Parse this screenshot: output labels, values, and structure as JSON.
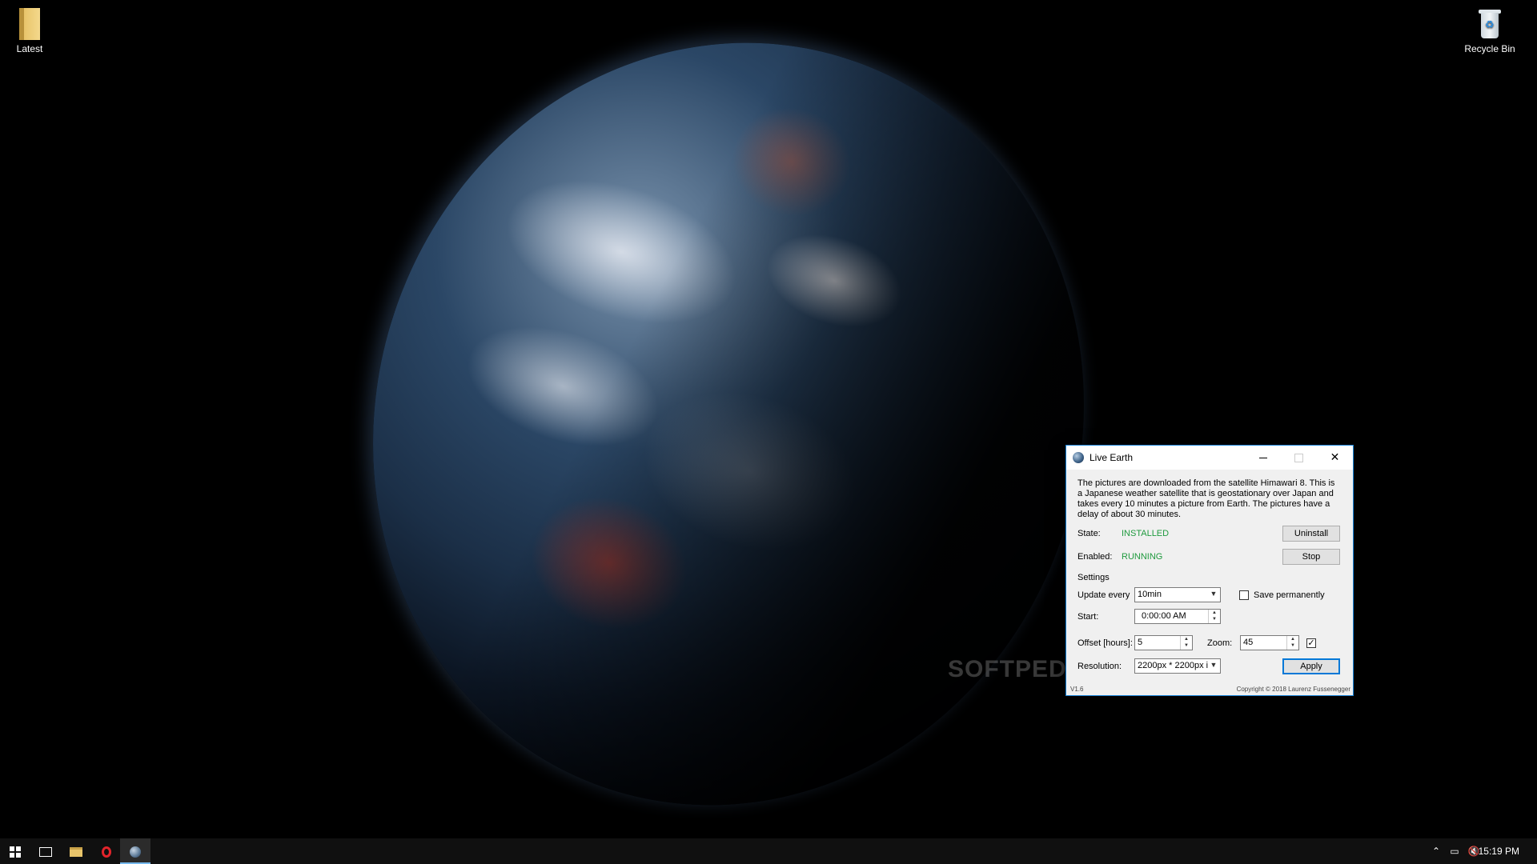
{
  "desktop": {
    "icons": [
      {
        "label": "Latest",
        "icon": "folder-icon"
      },
      {
        "label": "Recycle Bin",
        "icon": "recycle-bin-icon"
      }
    ],
    "watermark": "SOFTPEDIA"
  },
  "window": {
    "title": "Live Earth",
    "description": "The pictures are downloaded from the satellite Himawari 8. This is a Japanese weather satellite that is geostationary over Japan and takes every 10 minutes a picture from Earth. The pictures have a delay of about 30 minutes.",
    "state_label": "State:",
    "state_value": "INSTALLED",
    "enabled_label": "Enabled:",
    "enabled_value": "RUNNING",
    "uninstall_button": "Uninstall",
    "stop_button": "Stop",
    "settings_label": "Settings",
    "update_every_label": "Update every",
    "update_every_value": "10min",
    "save_permanently_label": "Save permanently",
    "save_permanently_checked": false,
    "start_label": "Start:",
    "start_value": "0:00:00 AM",
    "offset_label": "Offset [hours]:",
    "offset_value": "5",
    "zoom_label": "Zoom:",
    "zoom_value": "45",
    "zoom_checked": true,
    "resolution_label": "Resolution:",
    "resolution_value": "2200px * 2200px i",
    "apply_button": "Apply",
    "version": "V1.6",
    "copyright": "Copyright © 2018 Laurenz Fussenegger",
    "colors": {
      "status_green": "#1f9a3e",
      "accent": "#0078d7"
    }
  },
  "taskbar": {
    "items": [
      "start-icon",
      "task-view-icon",
      "file-explorer-icon",
      "opera-icon",
      "live-earth-icon"
    ],
    "tray_icons": [
      "chevron-up-icon",
      "network-icon",
      "volume-muted-icon"
    ],
    "clock": "15:19 PM"
  }
}
